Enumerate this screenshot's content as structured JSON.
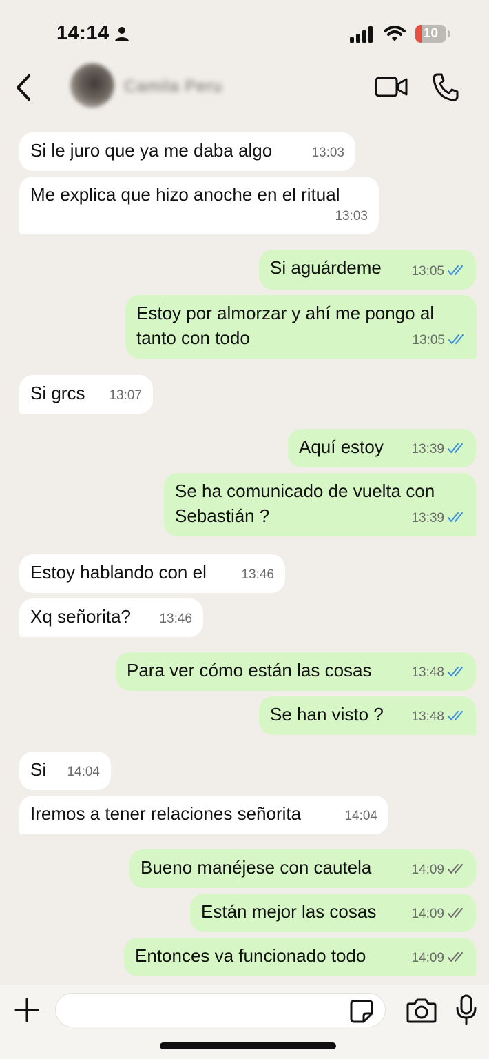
{
  "status_bar": {
    "time": "14:14",
    "battery_level": "10",
    "icons": [
      "person-icon",
      "signal-icon",
      "wifi-icon",
      "battery-icon"
    ],
    "battery_color": "#e94e40"
  },
  "header": {
    "contact_name": "Camila Peru",
    "icons": [
      "back-arrow-icon",
      "video-call-icon",
      "phone-icon"
    ]
  },
  "colors": {
    "background": "#f1eeea",
    "incoming_bubble": "#ffffff",
    "outgoing_bubble": "#d6f7c5",
    "read_tick": "#3b8ede",
    "delivered_tick": "#6b6b6b"
  },
  "messages": [
    {
      "direction": "in",
      "text": "Si le juro que ya me daba algo",
      "time": "13:03"
    },
    {
      "direction": "in",
      "text": "Me explica que hizo anoche en el ritual",
      "time": "13:03"
    },
    {
      "direction": "out",
      "text": "Si aguárdeme",
      "time": "13:05",
      "status": "read"
    },
    {
      "direction": "out",
      "text": "Estoy por almorzar y ahí me pongo al tanto con todo",
      "time": "13:05",
      "status": "read"
    },
    {
      "direction": "in",
      "text": "Si grcs",
      "time": "13:07"
    },
    {
      "direction": "out",
      "text": "Aquí estoy",
      "time": "13:39",
      "status": "read"
    },
    {
      "direction": "out",
      "text": "Se ha comunicado de vuelta con Sebastián ?",
      "time": "13:39",
      "status": "read"
    },
    {
      "direction": "in",
      "text": "Estoy hablando con el",
      "time": "13:46"
    },
    {
      "direction": "in",
      "text": "Xq señorita?",
      "time": "13:46"
    },
    {
      "direction": "out",
      "text": "Para ver cómo están las cosas",
      "time": "13:48",
      "status": "read"
    },
    {
      "direction": "out",
      "text": "Se han visto ?",
      "time": "13:48",
      "status": "read"
    },
    {
      "direction": "in",
      "text": "Si",
      "time": "14:04"
    },
    {
      "direction": "in",
      "text": "Iremos a tener relaciones señorita",
      "time": "14:04"
    },
    {
      "direction": "out",
      "text": "Bueno manéjese con cautela",
      "time": "14:09",
      "status": "delivered"
    },
    {
      "direction": "out",
      "text": "Están mejor las cosas",
      "time": "14:09",
      "status": "delivered"
    },
    {
      "direction": "out",
      "text": "Entonces va funcionado todo",
      "time": "14:09",
      "status": "delivered"
    }
  ],
  "composer": {
    "placeholder": "",
    "icons": [
      "plus-icon",
      "sticker-icon",
      "camera-icon",
      "microphone-icon"
    ]
  }
}
